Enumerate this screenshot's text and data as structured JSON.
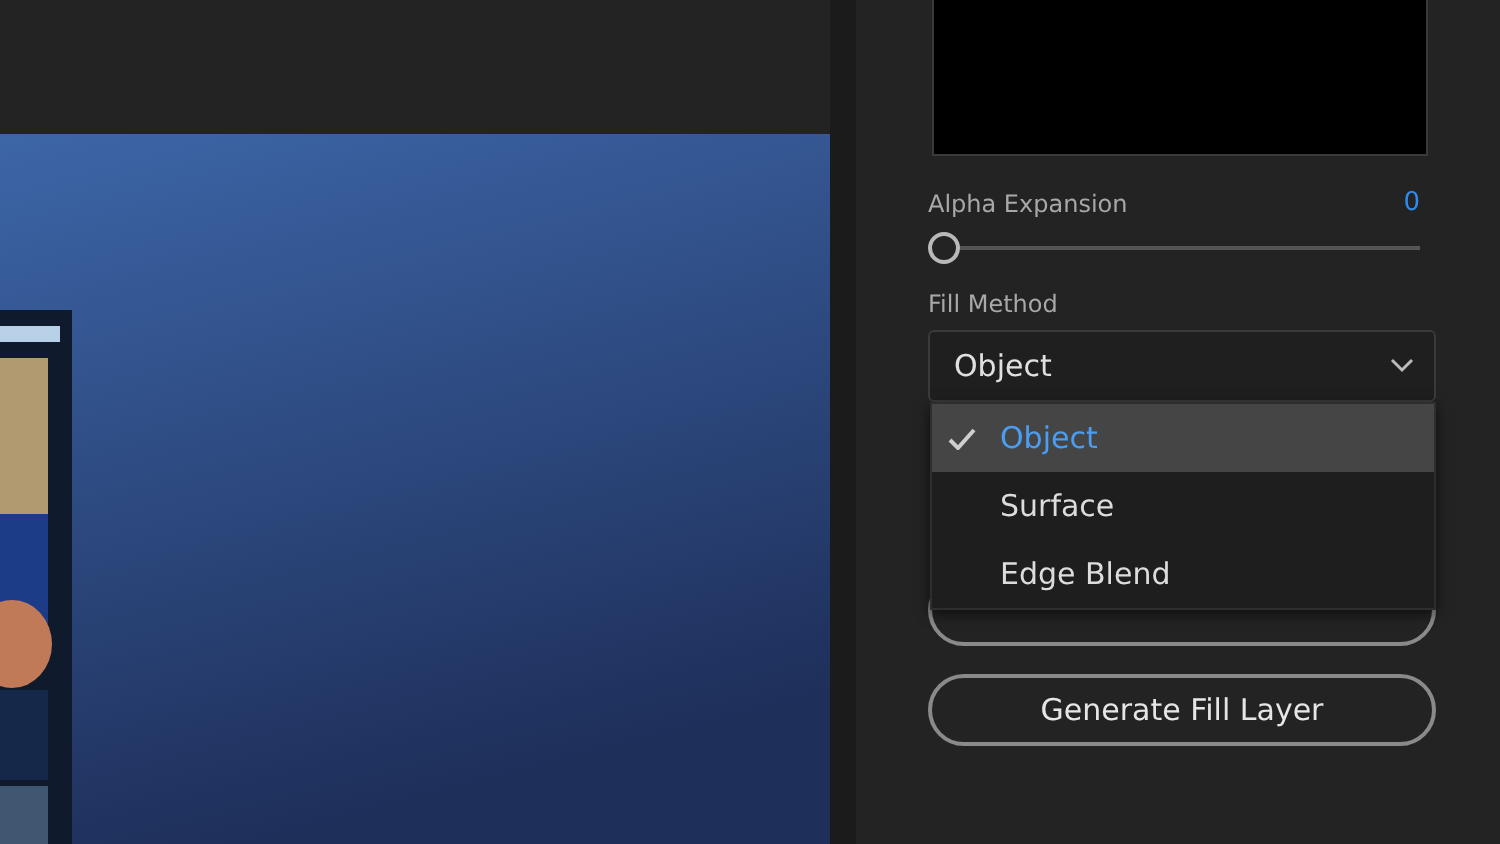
{
  "panel": {
    "alpha_expansion": {
      "label": "Alpha Expansion",
      "value": "0",
      "level": 0
    },
    "fill_method": {
      "label": "Fill Method",
      "value": "Object",
      "expanded": true,
      "options": [
        {
          "label": "Object",
          "selected": true
        },
        {
          "label": "Surface",
          "selected": false
        },
        {
          "label": "Edge Blend",
          "selected": false
        }
      ]
    },
    "buttons": [
      {
        "kind": "covered"
      },
      {
        "kind": "labeled",
        "label": "Generate Fill Layer"
      }
    ]
  }
}
